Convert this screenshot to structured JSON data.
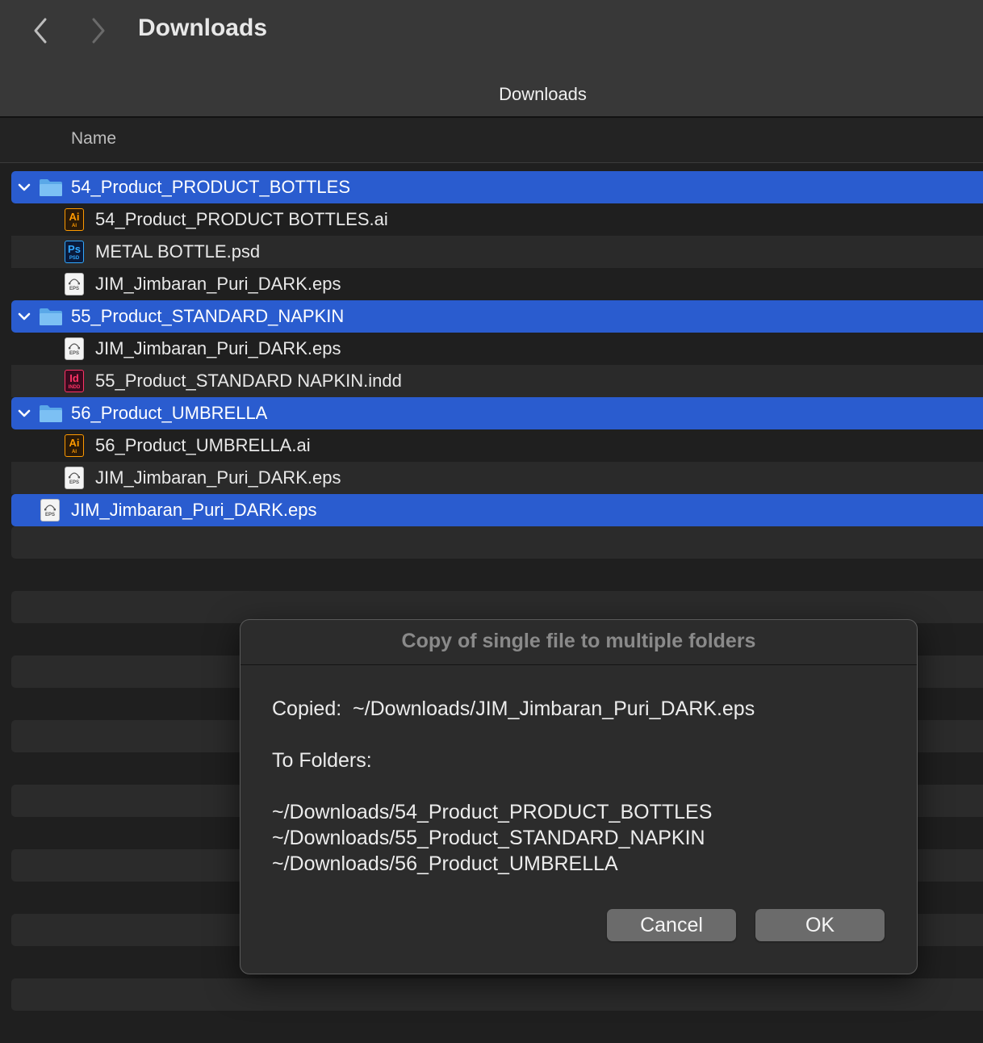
{
  "window": {
    "title": "Downloads",
    "path_title": "Downloads"
  },
  "toolbar": {
    "back_icon": "chevron-left-icon",
    "forward_icon": "chevron-right-icon"
  },
  "columns": {
    "name": "Name"
  },
  "folders": [
    {
      "name": "54_Product_PRODUCT_BOTTLES",
      "expanded": true,
      "files": [
        {
          "name": "54_Product_PRODUCT BOTTLES.ai",
          "type": "ai",
          "icon_label": "Ai",
          "icon_sub": "AI"
        },
        {
          "name": "METAL BOTTLE.psd",
          "type": "ps",
          "icon_label": "Ps",
          "icon_sub": "PSD"
        },
        {
          "name": "JIM_Jimbaran_Puri_DARK.eps",
          "type": "eps",
          "icon_label": "",
          "icon_sub": "EPS"
        }
      ]
    },
    {
      "name": "55_Product_STANDARD_NAPKIN",
      "expanded": true,
      "files": [
        {
          "name": "JIM_Jimbaran_Puri_DARK.eps",
          "type": "eps",
          "icon_label": "",
          "icon_sub": "EPS"
        },
        {
          "name": "55_Product_STANDARD NAPKIN.indd",
          "type": "id",
          "icon_label": "Id",
          "icon_sub": "INDD"
        }
      ]
    },
    {
      "name": "56_Product_UMBRELLA",
      "expanded": true,
      "files": [
        {
          "name": "56_Product_UMBRELLA.ai",
          "type": "ai",
          "icon_label": "Ai",
          "icon_sub": "AI"
        },
        {
          "name": "JIM_Jimbaran_Puri_DARK.eps",
          "type": "eps",
          "icon_label": "",
          "icon_sub": "EPS"
        }
      ]
    }
  ],
  "top_file": {
    "name": "JIM_Jimbaran_Puri_DARK.eps",
    "type": "eps",
    "icon_label": "",
    "icon_sub": "EPS"
  },
  "dialog": {
    "title": "Copy of single file to multiple folders",
    "copied_line": "Copied:  ~/Downloads/JIM_Jimbaran_Puri_DARK.eps",
    "to_folders_label": "To Folders:",
    "folder_lines": [
      "~/Downloads/54_Product_PRODUCT_BOTTLES",
      "~/Downloads/55_Product_STANDARD_NAPKIN",
      "~/Downloads/56_Product_UMBRELLA"
    ],
    "cancel_label": "Cancel",
    "ok_label": "OK"
  },
  "colors": {
    "selection": "#2a5ccf",
    "folder": "#5aa8e8",
    "ai": "#ff9a00",
    "ps": "#31a8ff",
    "id": "#ff3366"
  }
}
